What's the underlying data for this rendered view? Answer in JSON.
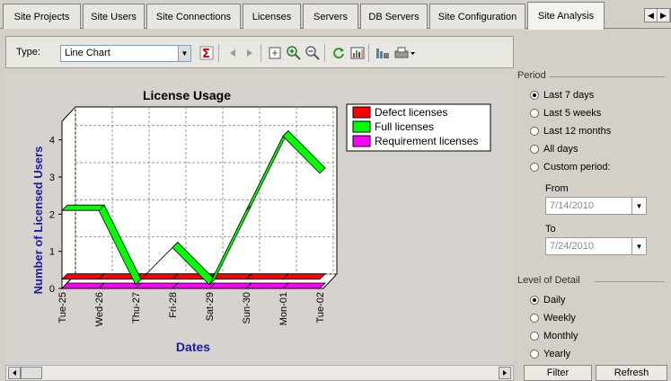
{
  "tabs": [
    {
      "label": "Site Projects",
      "active": false
    },
    {
      "label": "Site Users",
      "active": false
    },
    {
      "label": "Site Connections",
      "active": false
    },
    {
      "label": "Licenses",
      "active": false
    },
    {
      "label": "Servers",
      "active": false
    },
    {
      "label": "DB Servers",
      "active": false
    },
    {
      "label": "Site Configuration",
      "active": false
    },
    {
      "label": "Site Analysis",
      "active": true
    }
  ],
  "tab_nav": {
    "prev": "◀",
    "next": "▶"
  },
  "toolbar": {
    "type_label": "Type:",
    "type_value": "Line Chart",
    "dropdown_arrow": "▼"
  },
  "period": {
    "title": "Period",
    "options": [
      {
        "label": "Last 7 days",
        "selected": true
      },
      {
        "label": "Last 5 weeks",
        "selected": false
      },
      {
        "label": "Last 12 months",
        "selected": false
      },
      {
        "label": "All days",
        "selected": false
      },
      {
        "label": "Custom period:",
        "selected": false
      }
    ],
    "from_label": "From",
    "from_value": "7/14/2010",
    "to_label": "To",
    "to_value": "7/24/2010"
  },
  "detail": {
    "title": "Level of Detail",
    "options": [
      {
        "label": "Daily",
        "selected": true
      },
      {
        "label": "Weekly",
        "selected": false
      },
      {
        "label": "Monthly",
        "selected": false
      },
      {
        "label": "Yearly",
        "selected": false
      }
    ]
  },
  "buttons": {
    "filter": "Filter",
    "refresh": "Refresh"
  },
  "chart_data": {
    "type": "line",
    "title": "License Usage",
    "xlabel": "Dates",
    "ylabel": "Number of Licensed Users",
    "categories": [
      "Tue-25",
      "Wed-26",
      "Thu-27",
      "Fri-28",
      "Sat-29",
      "Sun-30",
      "Mon-01",
      "Tue-02"
    ],
    "yticks": [
      "0",
      "1",
      "2",
      "3",
      "4"
    ],
    "ylim": [
      0,
      4.5
    ],
    "grid": true,
    "legend_position": "top-right",
    "series": [
      {
        "name": "Defect licenses",
        "color": "#ff0000",
        "values": [
          0.25,
          0.25,
          0.25,
          0.25,
          0.25,
          0.25,
          0.25,
          0.25
        ]
      },
      {
        "name": "Full licenses",
        "color": "#00ff00",
        "values": [
          2.1,
          2.1,
          0.1,
          1.1,
          0.1,
          2.1,
          4.1,
          3.1
        ]
      },
      {
        "name": "Requirement licenses",
        "color": "#ff00ff",
        "values": [
          0,
          0,
          0,
          0,
          0,
          0,
          0,
          0
        ]
      }
    ]
  }
}
